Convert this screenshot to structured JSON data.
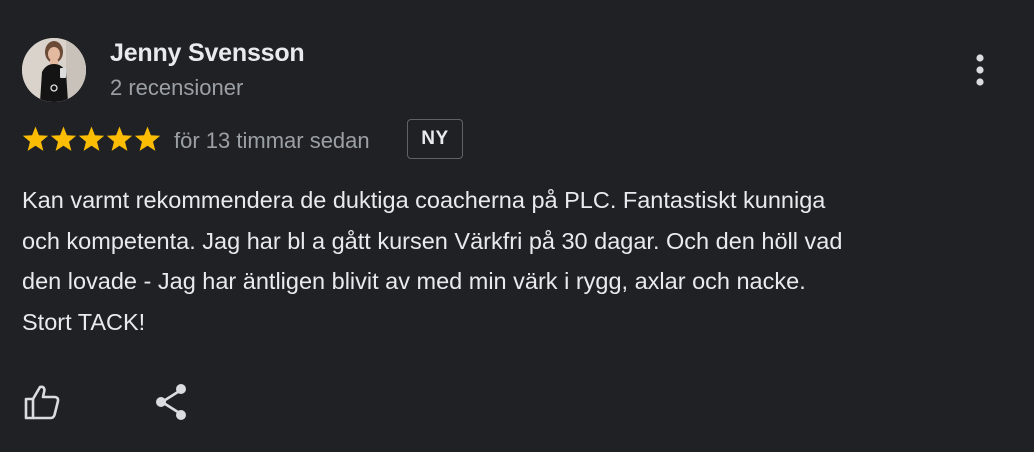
{
  "review": {
    "author": {
      "name": "Jenny Svensson",
      "meta": "2 recensioner"
    },
    "rating": 5,
    "rating_max": 5,
    "time": "för 13 timmar sedan",
    "badge": "NY",
    "text": "Kan varmt rekommendera de duktiga coacherna på PLC. Fantastiskt kunniga\noch kompetenta. Jag har bl a gått kursen Värkfri på 30 dagar. Och den höll vad\nden lovade - Jag har äntligen blivit av med min värk i rygg, axlar och nacke.\nStort TACK!"
  },
  "actions": {
    "like_icon": "thumb-up-icon",
    "share_icon": "share-icon",
    "more_icon": "more-vert-icon"
  },
  "colors": {
    "background": "#202124",
    "primary_text": "#e8eaed",
    "secondary_text": "#9aa0a6",
    "star": "#fbbc04",
    "badge_border": "#5f6368"
  }
}
